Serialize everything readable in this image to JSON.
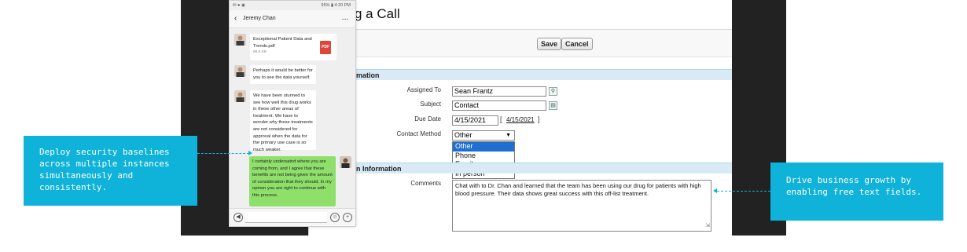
{
  "page": {
    "title_partial": "g a Call"
  },
  "form": {
    "save_label": "Save",
    "cancel_label": "Cancel",
    "section1": "mation",
    "section2": "n Information",
    "fields": {
      "assigned_to": {
        "label": "Assigned To",
        "value": "Sean Frantz"
      },
      "subject": {
        "label": "Subject",
        "value": "Contact"
      },
      "due_date": {
        "label": "Due Date",
        "value": "4/15/2021",
        "today_open": "[",
        "today_link": "4/15/2021",
        "today_close": "]"
      },
      "contact_method": {
        "label": "Contact Method",
        "value": "Other",
        "options": [
          "Other",
          "Phone",
          "Email",
          "In person"
        ]
      },
      "comments": {
        "label": "Comments",
        "value": "Chat with to Dr. Chan and learned that the team has been using our drug for patients with high blood pressure. Their data shows great success with this off-list treatment."
      }
    }
  },
  "phone": {
    "status_right": "95% ▮ 4:20 PM",
    "contact_name": "Jeremy Chan",
    "back_icon": "chevron-left-icon",
    "more_label": "...",
    "messages": [
      {
        "from": "them",
        "type": "file",
        "filename": "Exceptional Patient Data and Trends.pdf",
        "size": "98.5 KB",
        "badge": "PDF"
      },
      {
        "from": "them",
        "type": "text",
        "text": "Perhaps it would be better for you to see the data yourself."
      },
      {
        "from": "them",
        "type": "text",
        "text": "We have been stunned to see how well this drug works in these other areas of treatment. We have to wonder why these treatments are not considered for approval when the data for the primary use case is so much weaker."
      },
      {
        "from": "me",
        "type": "text",
        "text": "I certainly undersatnd where you are coming from, and I agree that these benefits are not being given the amount of consideration that they should. In my opinon you are right to continue with this process."
      }
    ]
  },
  "callouts": {
    "left": "Deploy security baselines across multiple instances simultaneously and consistently.",
    "right": "Drive business growth by enabling free text fields."
  },
  "colors": {
    "accent": "#0fb2d8",
    "section_bg": "#d7eaf5",
    "dark_bg": "#222222",
    "sent_bubble": "#8ee06b",
    "pdf_red": "#e0453a",
    "selected_option": "#1f6fd0"
  }
}
